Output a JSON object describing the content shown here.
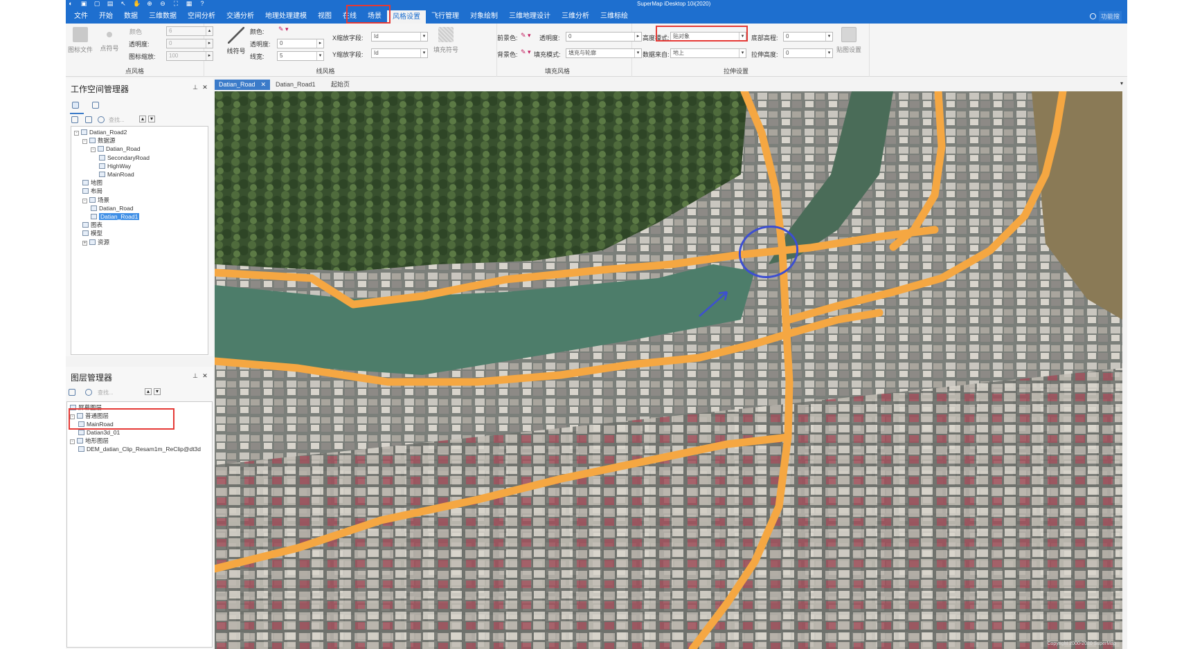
{
  "app": {
    "title": "SuperMap iDesktop 10i(2020)"
  },
  "quick_access": {
    "icons": [
      "app-logo-icon",
      "save-icon",
      "new-icon",
      "open-icon",
      "pointer-icon",
      "pan-icon",
      "zoom-in-icon",
      "zoom-out-icon",
      "fullextent-icon",
      "print-icon",
      "help-icon"
    ]
  },
  "menu": {
    "items": [
      "文件",
      "开始",
      "数据",
      "三维数据",
      "空间分析",
      "交通分析",
      "地理处理建模",
      "视图",
      "在线",
      "场景",
      "风格设置",
      "飞行管理",
      "对象绘制",
      "三维地理设计",
      "三维分析",
      "三维标绘"
    ],
    "active": "风格设置",
    "search_placeholder": "功能搜"
  },
  "ribbon": {
    "point_style": {
      "title": "点风格",
      "symbol_file": "图标文件",
      "point_symbol": "点符号",
      "color_label": "颜色",
      "size_value": "6",
      "opacity_label": "透明度:",
      "opacity_value": "0",
      "icon_scale_label": "图标缩放:",
      "icon_scale_value": "100"
    },
    "line_style": {
      "title": "线风格",
      "line_symbol": "线符号",
      "color_label": "颜色:",
      "opacity_label": "透明度:",
      "opacity_value": "0",
      "width_label": "线宽:",
      "width_value": "5",
      "x_scale_label": "X缩放字段:",
      "x_scale_value": "Id",
      "y_scale_label": "Y缩放字段:",
      "y_scale_value": "Id"
    },
    "fill_style": {
      "title": "填充风格",
      "fill_symbol": "填充符号",
      "fore_color_label": "前景色:",
      "back_color_label": "背景色:",
      "opacity_label": "透明度:",
      "opacity_value": "0",
      "fill_mode_label": "填充模式:",
      "fill_mode_value": "填充与轮廓"
    },
    "extrude": {
      "title": "拉伸设置",
      "altitude_mode_label": "高度模式:",
      "altitude_mode_value": "贴对象",
      "bottom_alt_label": "底部高程:",
      "bottom_alt_value": "0",
      "data_source_label": "数据来自:",
      "data_source_value": "地上",
      "extrude_height_label": "拉伸高度:",
      "extrude_height_value": "0",
      "texture_button": "贴图设置"
    }
  },
  "workspace": {
    "title": "工作空间管理器",
    "tree": [
      {
        "label": "Datian_Road2",
        "depth": 0,
        "toggle": "-"
      },
      {
        "label": "数据源",
        "depth": 1,
        "toggle": "-"
      },
      {
        "label": "Datian_Road",
        "depth": 2,
        "toggle": "-"
      },
      {
        "label": "SecondaryRoad",
        "depth": 3,
        "toggle": ""
      },
      {
        "label": "HighWay",
        "depth": 3,
        "toggle": ""
      },
      {
        "label": "MainRoad",
        "depth": 3,
        "toggle": ""
      },
      {
        "label": "地图",
        "depth": 1,
        "toggle": ""
      },
      {
        "label": "布局",
        "depth": 1,
        "toggle": ""
      },
      {
        "label": "场景",
        "depth": 1,
        "toggle": "-"
      },
      {
        "label": "Datian_Road",
        "depth": 2,
        "toggle": ""
      },
      {
        "label": "Datian_Road1",
        "depth": 2,
        "toggle": "",
        "selected": true
      },
      {
        "label": "图表",
        "depth": 1,
        "toggle": ""
      },
      {
        "label": "模型",
        "depth": 1,
        "toggle": ""
      },
      {
        "label": "资源",
        "depth": 1,
        "toggle": "+"
      }
    ],
    "search_placeholder": "查找..."
  },
  "layers": {
    "title": "图层管理器",
    "search_placeholder": "查找...",
    "tree": [
      {
        "label": "屏幕图层",
        "depth": 0,
        "toggle": ""
      },
      {
        "label": "普通图层",
        "depth": 0,
        "toggle": "-"
      },
      {
        "label": "MainRoad",
        "depth": 1,
        "toggle": ""
      },
      {
        "label": "Datian3d_01",
        "depth": 1,
        "toggle": ""
      },
      {
        "label": "地形图层",
        "depth": 0,
        "toggle": "-"
      },
      {
        "label": "DEM_datian_Clip_Resam1m_ReClip@dt3d",
        "depth": 1,
        "toggle": ""
      }
    ]
  },
  "doc_tabs": {
    "tabs": [
      "Datian_Road",
      "Datian_Road1",
      "起始页"
    ],
    "active": "Datian_Road"
  },
  "map": {
    "copyright": "Copyright 2000-2020 SuperMap",
    "road_color": "#f5a742"
  }
}
